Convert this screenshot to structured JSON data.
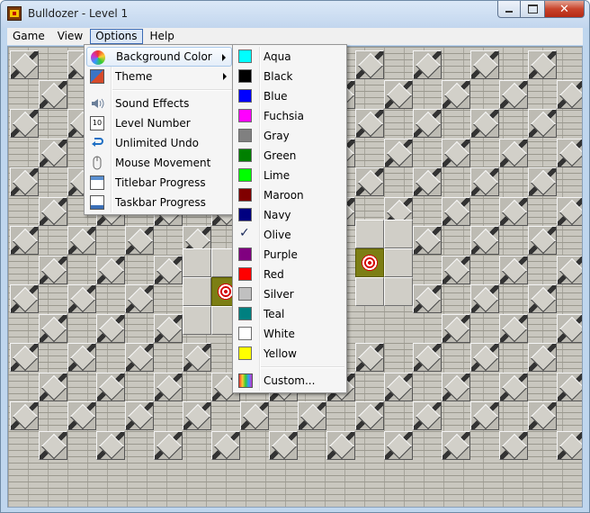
{
  "window": {
    "title": "Bulldozer - Level 1",
    "close_glyph": "✕"
  },
  "menubar": [
    "Game",
    "View",
    "Options",
    "Help"
  ],
  "options_menu": {
    "items": [
      {
        "label": "Background Color",
        "icon": "palette-icon",
        "submenu": true
      },
      {
        "label": "Theme",
        "icon": "theme-icon",
        "submenu": true
      },
      {
        "label": "Sound Effects",
        "icon": "speaker-icon"
      },
      {
        "label": "Level Number",
        "icon": "level-number-icon"
      },
      {
        "label": "Unlimited Undo",
        "icon": "undo-icon"
      },
      {
        "label": "Mouse Movement",
        "icon": "mouse-icon"
      },
      {
        "label": "Titlebar Progress",
        "icon": "titlebar-icon"
      },
      {
        "label": "Taskbar Progress",
        "icon": "taskbar-icon"
      }
    ]
  },
  "color_menu": {
    "selected": "Olive",
    "colors": [
      {
        "label": "Aqua",
        "hex": "#00ffff"
      },
      {
        "label": "Black",
        "hex": "#000000"
      },
      {
        "label": "Blue",
        "hex": "#0000ff"
      },
      {
        "label": "Fuchsia",
        "hex": "#ff00ff"
      },
      {
        "label": "Gray",
        "hex": "#808080"
      },
      {
        "label": "Green",
        "hex": "#008000"
      },
      {
        "label": "Lime",
        "hex": "#00ff00"
      },
      {
        "label": "Maroon",
        "hex": "#800000"
      },
      {
        "label": "Navy",
        "hex": "#000080"
      },
      {
        "label": "Olive",
        "hex": "#808000"
      },
      {
        "label": "Purple",
        "hex": "#800080"
      },
      {
        "label": "Red",
        "hex": "#ff0000"
      },
      {
        "label": "Silver",
        "hex": "#c0c0c0"
      },
      {
        "label": "Teal",
        "hex": "#008080"
      },
      {
        "label": "White",
        "hex": "#ffffff"
      },
      {
        "label": "Yellow",
        "hex": "#ffff00"
      }
    ],
    "custom_label": "Custom..."
  }
}
